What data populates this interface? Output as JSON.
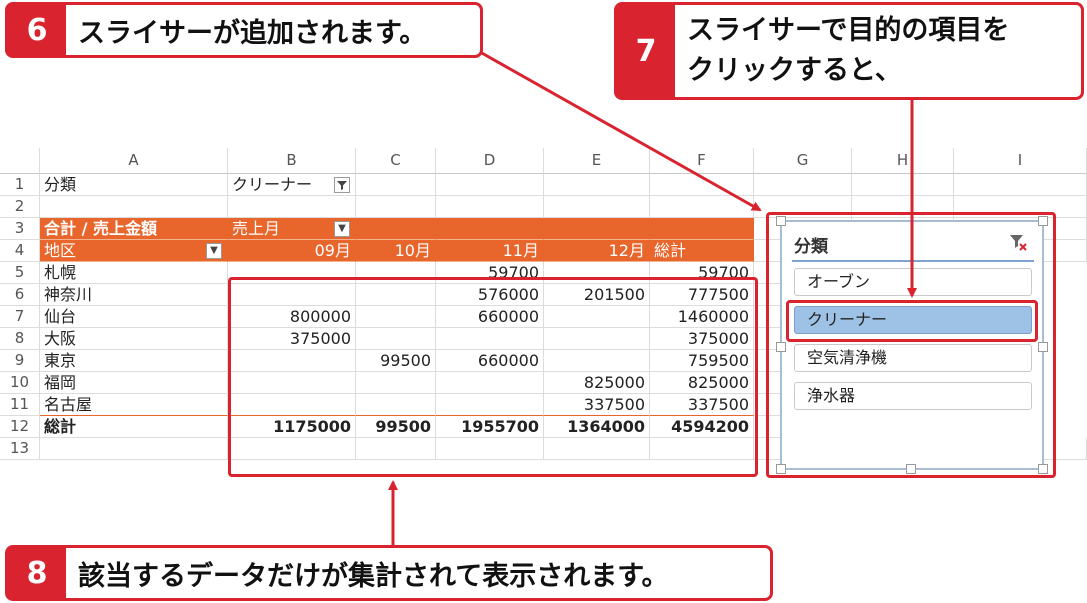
{
  "callouts": {
    "c6": {
      "num": "6",
      "text": "スライサーが追加されます。"
    },
    "c7": {
      "num": "7",
      "line1": "スライサーで目的の項目を",
      "line2": "クリックすると、"
    },
    "c8": {
      "num": "8",
      "text": "該当するデータだけが集計されて表示されます。"
    }
  },
  "sheet": {
    "columns": [
      "A",
      "B",
      "C",
      "D",
      "E",
      "F",
      "G",
      "H",
      "I"
    ],
    "rows": [
      "1",
      "2",
      "3",
      "4",
      "5",
      "6",
      "7",
      "8",
      "9",
      "10",
      "11",
      "12",
      "13"
    ],
    "a1": "分類",
    "b1": "クリーナー",
    "a3": "合計 / 売上金額",
    "b3": "売上月",
    "a4": "地区",
    "months": [
      "09月",
      "10月",
      "11月",
      "12月"
    ],
    "total_label": "総計",
    "data_rows": [
      {
        "area": "札幌",
        "v": [
          "",
          "",
          "59700",
          "",
          "59700"
        ]
      },
      {
        "area": "神奈川",
        "v": [
          "",
          "",
          "576000",
          "201500",
          "777500"
        ]
      },
      {
        "area": "仙台",
        "v": [
          "800000",
          "",
          "660000",
          "",
          "1460000"
        ]
      },
      {
        "area": "大阪",
        "v": [
          "375000",
          "",
          "",
          "",
          "375000"
        ]
      },
      {
        "area": "東京",
        "v": [
          "",
          "99500",
          "660000",
          "",
          "759500"
        ]
      },
      {
        "area": "福岡",
        "v": [
          "",
          "",
          "",
          "825000",
          "825000"
        ]
      },
      {
        "area": "名古屋",
        "v": [
          "",
          "",
          "",
          "337500",
          "337500"
        ]
      }
    ],
    "grand_total": {
      "label": "総計",
      "v": [
        "1175000",
        "99500",
        "1955700",
        "1364000",
        "4594200"
      ]
    }
  },
  "slicer": {
    "title": "分類",
    "items": [
      {
        "label": "オーブン",
        "selected": false
      },
      {
        "label": "クリーナー",
        "selected": true
      },
      {
        "label": "空気清浄機",
        "selected": false
      },
      {
        "label": "浄水器",
        "selected": false
      }
    ]
  },
  "colors": {
    "accent_red": "#d9232f",
    "pivot_orange": "#e8662b",
    "slicer_selected": "#9ec1e6"
  }
}
